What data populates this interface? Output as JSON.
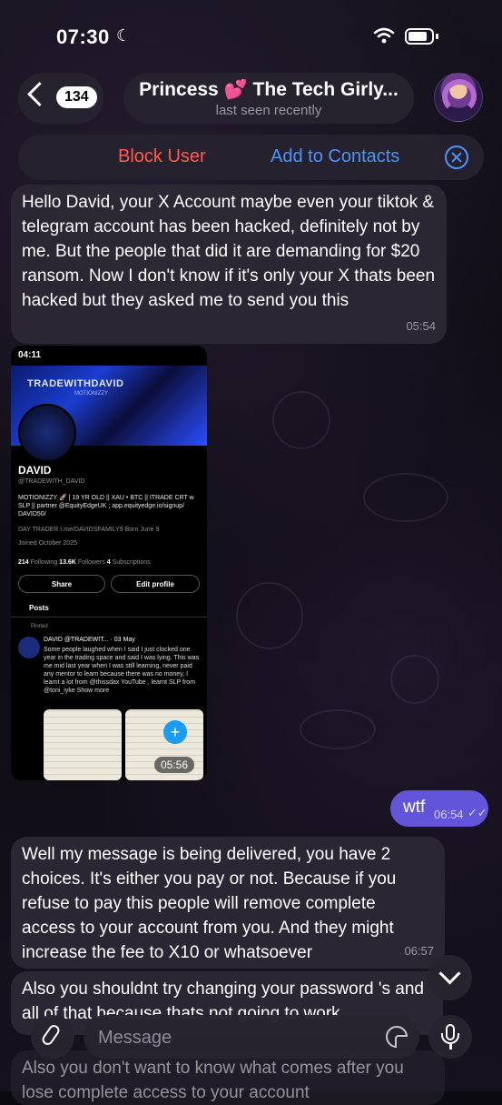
{
  "status": {
    "time": "07:30"
  },
  "header": {
    "back_count": "134",
    "title": "Princess 💕 The Tech Girly...",
    "subtitle": "last seen recently"
  },
  "actions": {
    "block": "Block User",
    "add": "Add to Contacts"
  },
  "messages": [
    {
      "text": "Hello David, your X Account maybe even your tiktok & telegram account has been hacked, definitely not by me. But the people that did it are demanding for $20 ransom. Now I don't know if it's only your X thats been hacked but they asked me to send you this",
      "time": "05:54"
    },
    {
      "text": "wtf",
      "time": "06:54"
    },
    {
      "text": "Well my message is being delivered, you have 2 choices. It's either you pay or not. Because if you refuse to pay this people will remove complete access to your account from you. And they might increase the fee to X10 or whatsoever",
      "time": "06:57"
    },
    {
      "text": "Also you shouldnt try changing your password 's and all of that because thats not going to work"
    },
    {
      "text": "Also you don't want to know what comes after you lose complete access to your account"
    }
  ],
  "screenshot": {
    "time": "05:56",
    "status_time": "04:11",
    "banner": "TRADEWITHDAVID",
    "banner_sub": "MOTIONIZZY",
    "name": "DAVID",
    "handle": "@TRADEWITH_DAVID",
    "bio": "MOTIONIZZY 🚀 | 19 YR OLD || XAU • BTC || ITRADE CRT w SLP || partner @EquityEdgeUK ; app.equityedge.io/signup/ DAVID50/",
    "meta_line": "DAY TRADER  t.me/DAVIDSFAMILY9  Born June 9",
    "joined": "Joined October 2025",
    "following": "214",
    "following_label": "Following",
    "followers": "13.6K",
    "followers_label": "Followers",
    "subs": "4",
    "subs_label": "Subscriptions",
    "share": "Share",
    "edit": "Edit profile",
    "tab_posts": "Posts",
    "pinned": "Pinned",
    "post_head": "DAVID @TRADEWIT... · 03 May",
    "post_text": "Some people laughed when I said I just clocked one year in the trading space and said I was lying. This was me mid last year when I was still learning, never paid any mentor to learn because there was no money, I learnt a lot from @thissdax YouTube , learnt SLP from @toni_iyke Show more"
  },
  "composer": {
    "placeholder": "Message"
  },
  "colors": {
    "accent": "#4e94f7",
    "danger": "#ff5c4d",
    "outgoing": "#6355d9"
  }
}
